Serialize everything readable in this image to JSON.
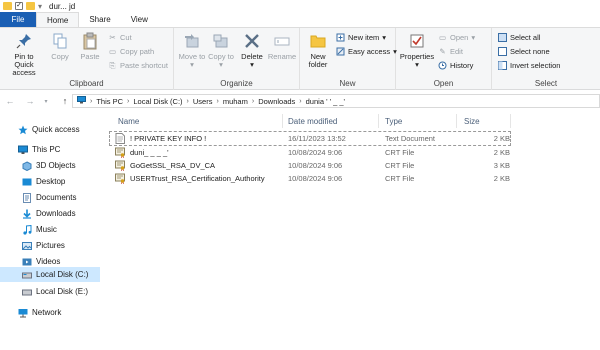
{
  "window": {
    "title": "dur... jd"
  },
  "tabs": {
    "file": "File",
    "home": "Home",
    "share": "Share",
    "view": "View"
  },
  "ribbon": {
    "clipboard": {
      "label": "Clipboard",
      "pin": "Pin to Quick access",
      "copy": "Copy",
      "paste": "Paste",
      "cut": "Cut",
      "copy_path": "Copy path",
      "paste_shortcut": "Paste shortcut"
    },
    "organize": {
      "label": "Organize",
      "move_to": "Move to",
      "copy_to": "Copy to",
      "delete": "Delete",
      "rename": "Rename"
    },
    "new": {
      "label": "New",
      "new_folder": "New folder",
      "new_item": "New item",
      "easy_access": "Easy access"
    },
    "open": {
      "label": "Open",
      "properties": "Properties",
      "open": "Open",
      "edit": "Edit",
      "history": "History"
    },
    "select": {
      "label": "Select",
      "select_all": "Select all",
      "select_none": "Select none",
      "invert_selection": "Invert selection"
    }
  },
  "breadcrumb": [
    "This PC",
    "Local Disk (C:)",
    "Users",
    "muham",
    "Downloads",
    "dunia ' ' _ _'"
  ],
  "nav": {
    "quick_access": "Quick access",
    "this_pc": "This PC",
    "objects_3d": "3D Objects",
    "desktop": "Desktop",
    "documents": "Documents",
    "downloads": "Downloads",
    "music": "Music",
    "pictures": "Pictures",
    "videos": "Videos",
    "local_disk_c": "Local Disk (C:)",
    "local_disk_e": "Local Disk (E:)",
    "network": "Network"
  },
  "columns": {
    "name": "Name",
    "date_modified": "Date modified",
    "type": "Type",
    "size": "Size"
  },
  "files": [
    {
      "name": "! PRIVATE KEY INFO !",
      "date": "16/11/2023 13:52",
      "type": "Text Document",
      "size": "2 KB"
    },
    {
      "name": "duni_ _ _ _'",
      "date": "10/08/2024 9:06",
      "type": "CRT File",
      "size": "2 KB"
    },
    {
      "name": "GoGetSSL_RSA_DV_CA",
      "date": "10/08/2024 9:06",
      "type": "CRT File",
      "size": "3 KB"
    },
    {
      "name": "USERTrust_RSA_Certification_Authority",
      "date": "10/08/2024 9:06",
      "type": "CRT File",
      "size": "2 KB"
    }
  ],
  "colors": {
    "file_tab": "#1a5fb4",
    "selected_nav": "#cde8ff",
    "folder": "#f5c542",
    "column_header_text": "#4c607a"
  }
}
